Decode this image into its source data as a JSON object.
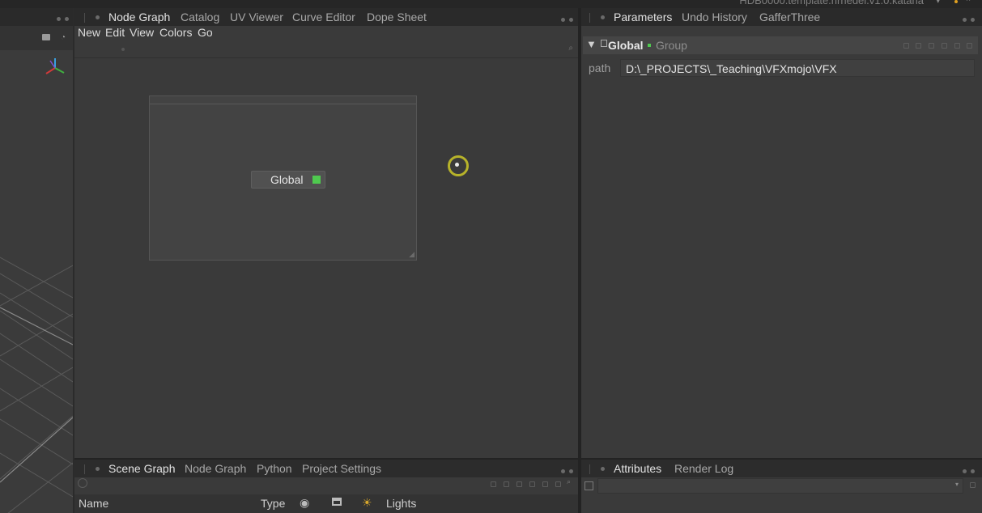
{
  "window": {
    "title": "HDB0000.template.nrnedel.v1.0.katana"
  },
  "viewer": {},
  "node_graph_panel": {
    "tabs": [
      {
        "label": "Node Graph",
        "active": true
      },
      {
        "label": "Catalog"
      },
      {
        "label": "UV Viewer"
      },
      {
        "label": "Curve Editor"
      },
      {
        "label": "Dope Sheet"
      }
    ],
    "menu": [
      "New",
      "Edit",
      "View",
      "Colors",
      "Go"
    ],
    "node": {
      "label": "Global",
      "status_color": "#4fc94f"
    }
  },
  "parameters_panel": {
    "tabs": [
      {
        "label": "Parameters",
        "active": true
      },
      {
        "label": "Undo History"
      },
      {
        "label": "GafferThree"
      }
    ],
    "node_name": "Global",
    "node_type": "Group",
    "path_label": "path",
    "path_value": "D:\\_PROJECTS\\_Teaching\\VFXmojo\\VFX"
  },
  "scene_graph_panel": {
    "tabs": [
      {
        "label": "Scene Graph",
        "active": true
      },
      {
        "label": "Node Graph"
      },
      {
        "label": "Python"
      },
      {
        "label": "Project Settings"
      }
    ],
    "columns": {
      "name": "Name",
      "type": "Type",
      "lights": "Lights"
    }
  },
  "attributes_panel": {
    "tabs": [
      {
        "label": "Attributes",
        "active": true
      },
      {
        "label": "Render Log"
      }
    ]
  },
  "colors": {
    "accent": "#4fc94f",
    "cursor_ring": "#b7b32a"
  }
}
